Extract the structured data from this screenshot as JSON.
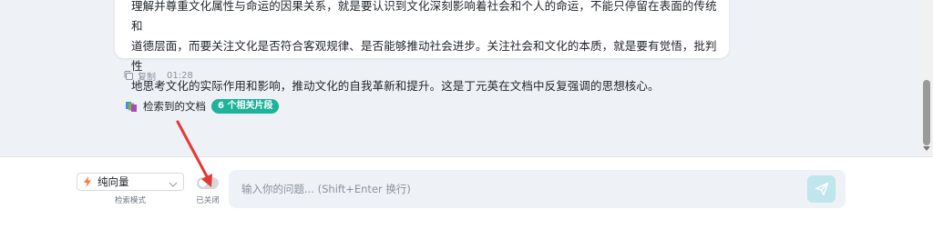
{
  "answer": {
    "text": "理解并尊重文化属性与命运的因果关系，就是要认识到文化深刻影响着社会和个人的命运，不能只停留在表面的传统和\n道德层面，而要关注文化是否符合客观规律、是否能够推动社会进步。关注社会和文化的本质，就是要有觉悟，批判性\n地思考文化的实际作用和影响，推动文化的自我革新和提升。这是丁元英在文档中反复强调的思想核心。"
  },
  "meta": {
    "copy_label": "复制",
    "time": "01:28"
  },
  "retrieval": {
    "label": "检索到的文档",
    "badge": "6 个相关片段"
  },
  "input_bar": {
    "mode_value": "纯向量",
    "mode_caption": "检索模式",
    "toggle_caption": "已关闭",
    "toggle_on": false,
    "placeholder": "输入你的问题... (Shift+Enter 换行)"
  },
  "colors": {
    "accent": "#1fb39a",
    "send_button": "#bfe6ec",
    "annotation_arrow": "#e53935"
  },
  "icons": {
    "copy": "copy-icon",
    "docs": "documents-icon",
    "mode": "bolt-icon",
    "dropdown": "chevron-down-icon",
    "send": "send-icon"
  }
}
